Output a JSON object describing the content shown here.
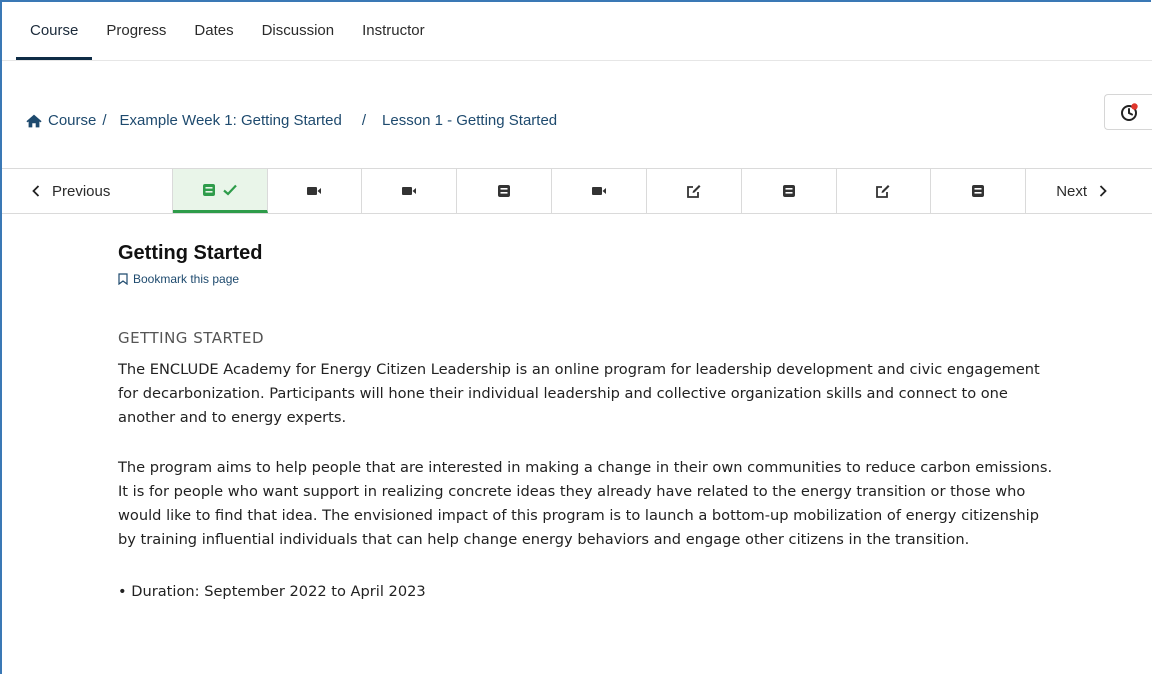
{
  "topnav": {
    "tabs": [
      {
        "label": "Course",
        "active": true
      },
      {
        "label": "Progress",
        "active": false
      },
      {
        "label": "Dates",
        "active": false
      },
      {
        "label": "Discussion",
        "active": false
      },
      {
        "label": "Instructor",
        "active": false
      }
    ]
  },
  "breadcrumb": {
    "home_icon": "home-icon",
    "course": "Course",
    "separator": "/",
    "week": "Example Week 1: Getting Started",
    "lesson": "Lesson 1 - Getting Started"
  },
  "timer": {
    "icon": "clock-icon",
    "badge_color": "#e0362c"
  },
  "sequence": {
    "previous_label": "Previous",
    "next_label": "Next",
    "units": [
      {
        "icon": "document-icon",
        "completed": true,
        "active": true
      },
      {
        "icon": "video-icon",
        "completed": false,
        "active": false
      },
      {
        "icon": "video-icon",
        "completed": false,
        "active": false
      },
      {
        "icon": "document-icon",
        "completed": false,
        "active": false
      },
      {
        "icon": "video-icon",
        "completed": false,
        "active": false
      },
      {
        "icon": "edit-icon",
        "completed": false,
        "active": false
      },
      {
        "icon": "document-icon",
        "completed": false,
        "active": false
      },
      {
        "icon": "edit-icon",
        "completed": false,
        "active": false
      },
      {
        "icon": "document-icon",
        "completed": false,
        "active": false
      }
    ]
  },
  "content": {
    "title": "Getting Started",
    "bookmark_label": "Bookmark this page",
    "section_heading": "GETTING STARTED",
    "paragraph1": "The ENCLUDE Academy for Energy Citizen Leadership is an online program for leadership development and civic engagement for decarbonization. Participants will hone their individual leadership and collective organization skills and connect to one another and to energy experts.",
    "paragraph2": "The program aims to help people that are interested in making a change in their own communities to reduce carbon emissions. It is for people who want support in realizing concrete ideas they already have related to the energy transition or those who would like to find that idea. The envisioned impact of this program is to launch a bottom-up mobilization of energy citizenship by training influential individuals that can help change energy behaviors and engage other citizens in the transition.",
    "bullets": [
      "Duration: September 2022 to April 2023"
    ]
  },
  "colors": {
    "accent_green": "#2e9c4a",
    "link_blue": "#1e4a6e",
    "active_tab_underline": "#0e2c46"
  }
}
